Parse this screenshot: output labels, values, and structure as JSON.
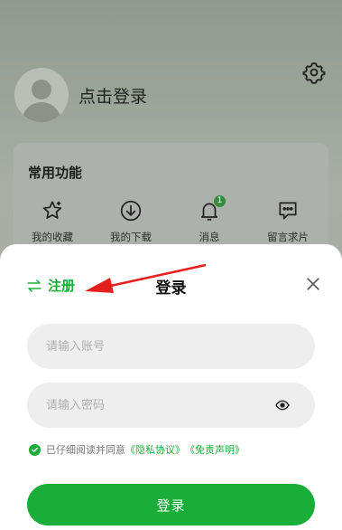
{
  "profile": {
    "login_prompt": "点击登录"
  },
  "features": {
    "title": "常用功能",
    "items": [
      {
        "label": "我的收藏",
        "icon": "star-icon"
      },
      {
        "label": "我的下载",
        "icon": "download-icon"
      },
      {
        "label": "消息",
        "icon": "bell-icon",
        "badge": "1"
      },
      {
        "label": "留言求片",
        "icon": "message-icon"
      }
    ]
  },
  "sheet": {
    "register_label": "注册",
    "title": "登录",
    "account_placeholder": "请输入账号",
    "password_placeholder": "请输入密码",
    "agreement_prefix": "已仔细阅读并同意",
    "privacy_link": "《隐私协议》",
    "disclaimer_link": "《免责声明》",
    "login_button": "登录"
  },
  "colors": {
    "accent": "#1aad3a",
    "arrow": "#e3201b"
  }
}
